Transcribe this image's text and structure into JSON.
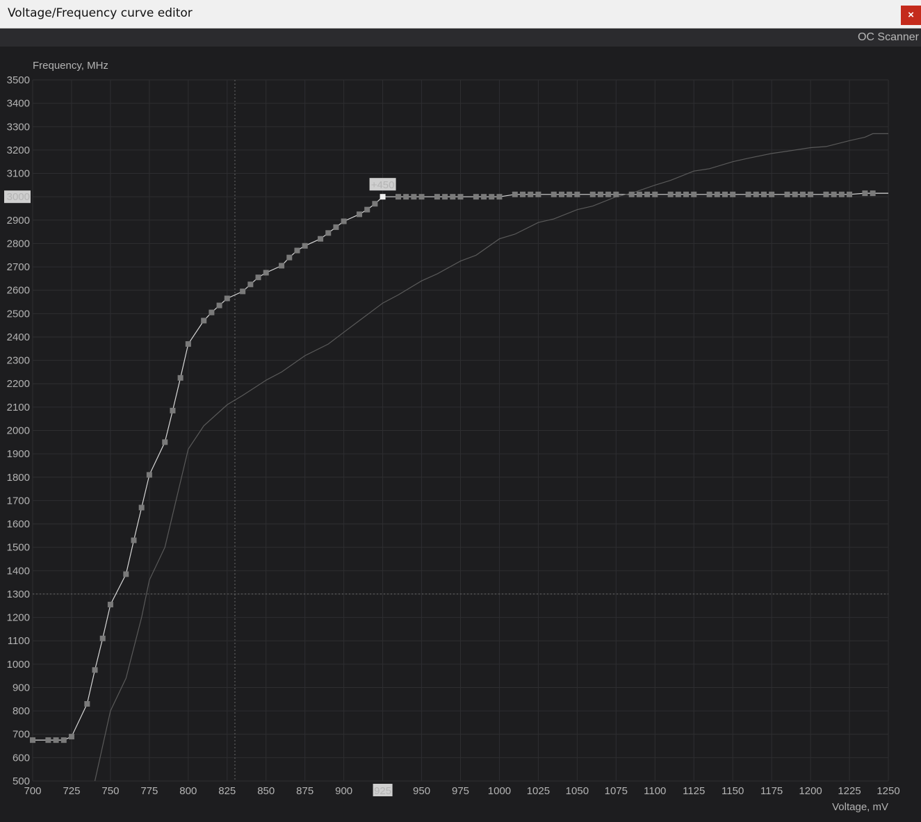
{
  "window": {
    "title": "Voltage/Frequency curve editor",
    "close_label": "×"
  },
  "toolbar": {
    "oc_scanner_label": "OC Scanner"
  },
  "colors": {
    "background": "#1d1d1f",
    "grid": "#2e2e31",
    "edited_curve": "#d8d8d8",
    "default_curve": "#5a5a5a",
    "points": "#7a7a7a",
    "selected_point": "#f0f0f0",
    "highlight_label_bg": "#cfcfcf",
    "close_button": "#c42b1c"
  },
  "chart_data": {
    "type": "line",
    "ylabel": "Frequency, MHz",
    "xlabel": "Voltage, mV",
    "xlim": [
      700,
      1250
    ],
    "ylim": [
      500,
      3500
    ],
    "grid": true,
    "x_ticks": [
      700,
      725,
      750,
      775,
      800,
      825,
      850,
      875,
      900,
      925,
      950,
      975,
      1000,
      1025,
      1050,
      1075,
      1100,
      1125,
      1150,
      1175,
      1200,
      1225,
      1250
    ],
    "y_ticks": [
      500,
      600,
      700,
      800,
      900,
      1000,
      1100,
      1200,
      1300,
      1400,
      1500,
      1600,
      1700,
      1800,
      1900,
      2000,
      2100,
      2200,
      2300,
      2400,
      2500,
      2600,
      2700,
      2800,
      2900,
      3000,
      3100,
      3200,
      3300,
      3400,
      3500
    ],
    "highlighted_x_tick": 925,
    "highlighted_y_tick": 3000,
    "selected_point": {
      "x": 925,
      "y": 3000,
      "offset_label": "+450"
    },
    "cursor_crosshair": {
      "x": 830,
      "y": 1300
    },
    "series": [
      {
        "role": "edited",
        "x": [
          700,
          710,
          715,
          720,
          725,
          735,
          740,
          745,
          750,
          760,
          765,
          770,
          775,
          785,
          790,
          795,
          800,
          810,
          815,
          820,
          825,
          835,
          840,
          845,
          850,
          860,
          865,
          870,
          875,
          885,
          890,
          895,
          900,
          910,
          915,
          920,
          925,
          935,
          940,
          945,
          950,
          960,
          965,
          970,
          975,
          985,
          990,
          995,
          1000,
          1010,
          1015,
          1020,
          1025,
          1035,
          1040,
          1045,
          1050,
          1060,
          1065,
          1070,
          1075,
          1085,
          1090,
          1095,
          1100,
          1110,
          1115,
          1120,
          1125,
          1135,
          1140,
          1145,
          1150,
          1160,
          1165,
          1170,
          1175,
          1185,
          1190,
          1195,
          1200,
          1210,
          1215,
          1220,
          1225,
          1235,
          1240,
          1250
        ],
        "y": [
          675,
          675,
          675,
          675,
          690,
          830,
          975,
          1110,
          1255,
          1385,
          1530,
          1670,
          1810,
          1950,
          2085,
          2225,
          2370,
          2470,
          2505,
          2535,
          2565,
          2595,
          2625,
          2655,
          2675,
          2705,
          2740,
          2770,
          2790,
          2820,
          2845,
          2870,
          2895,
          2925,
          2945,
          2970,
          3000,
          3000,
          3000,
          3000,
          3000,
          3000,
          3000,
          3000,
          3000,
          3000,
          3000,
          3000,
          3000,
          3010,
          3010,
          3010,
          3010,
          3010,
          3010,
          3010,
          3010,
          3010,
          3010,
          3010,
          3010,
          3010,
          3010,
          3010,
          3010,
          3010,
          3010,
          3010,
          3010,
          3010,
          3010,
          3010,
          3010,
          3010,
          3010,
          3010,
          3010,
          3010,
          3010,
          3010,
          3010,
          3010,
          3010,
          3010,
          3010,
          3015,
          3015,
          3015
        ],
        "marker_points": [
          700,
          710,
          715,
          720,
          725,
          735,
          740,
          745,
          750,
          760,
          765,
          770,
          775,
          785,
          790,
          795,
          800,
          810,
          815,
          820,
          825,
          835,
          840,
          845,
          850,
          860,
          865,
          870,
          875,
          885,
          890,
          895,
          900,
          910,
          915,
          920,
          925,
          935,
          940,
          945,
          950,
          960,
          965,
          970,
          975,
          985,
          990,
          995,
          1000,
          1010,
          1015,
          1020,
          1025,
          1035,
          1040,
          1045,
          1050,
          1060,
          1065,
          1070,
          1075,
          1085,
          1090,
          1095,
          1100,
          1110,
          1115,
          1120,
          1125,
          1135,
          1140,
          1145,
          1150,
          1160,
          1165,
          1170,
          1175,
          1185,
          1190,
          1195,
          1200,
          1210,
          1215,
          1220,
          1225,
          1235,
          1240
        ]
      },
      {
        "role": "default",
        "x": [
          740,
          750,
          760,
          770,
          775,
          785,
          800,
          810,
          825,
          835,
          850,
          860,
          875,
          890,
          900,
          910,
          925,
          935,
          950,
          960,
          975,
          985,
          1000,
          1010,
          1025,
          1035,
          1050,
          1060,
          1075,
          1085,
          1100,
          1110,
          1125,
          1135,
          1150,
          1160,
          1175,
          1185,
          1200,
          1210,
          1225,
          1235,
          1240,
          1250
        ],
        "y": [
          500,
          800,
          940,
          1200,
          1360,
          1500,
          1920,
          2020,
          2110,
          2150,
          2215,
          2250,
          2320,
          2370,
          2420,
          2470,
          2545,
          2580,
          2640,
          2670,
          2725,
          2750,
          2820,
          2840,
          2890,
          2905,
          2945,
          2960,
          3000,
          3015,
          3050,
          3070,
          3110,
          3120,
          3150,
          3165,
          3185,
          3195,
          3210,
          3215,
          3240,
          3255,
          3270,
          3270
        ]
      }
    ]
  }
}
